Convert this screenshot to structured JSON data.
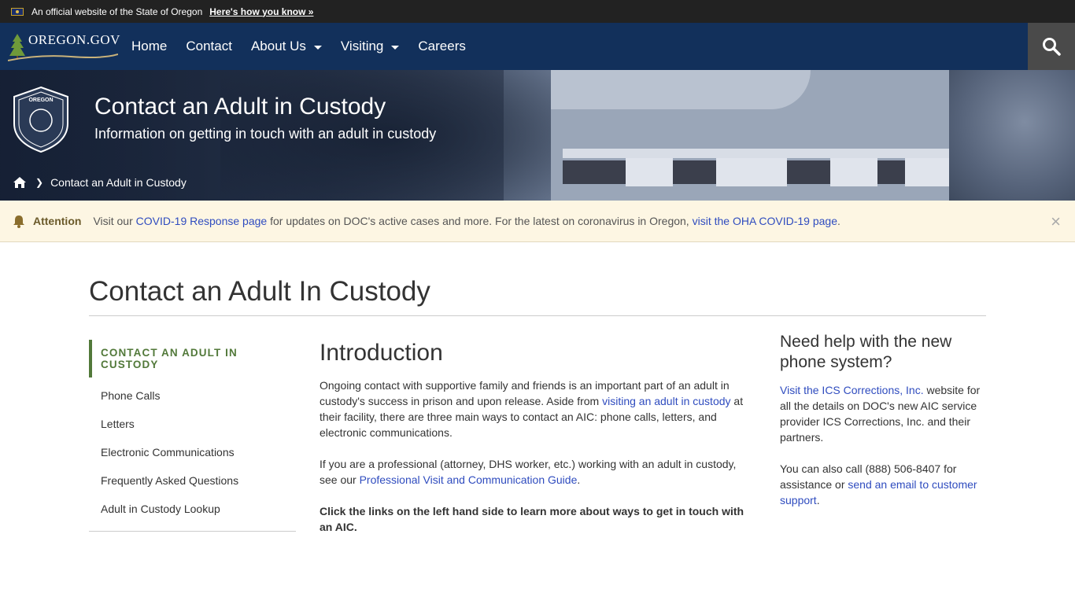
{
  "official_bar": {
    "text": "An official website of the State of Oregon",
    "link": "Here's how you know »"
  },
  "nav": {
    "logo_text": "OREGON.GOV",
    "items": [
      {
        "label": "Home"
      },
      {
        "label": "Contact"
      },
      {
        "label": "About Us"
      },
      {
        "label": "Visiting"
      },
      {
        "label": "Careers"
      }
    ],
    "search_icon": "search-icon"
  },
  "hero": {
    "title": "Contact an Adult in Custody",
    "subtitle": "Information on getting in touch with an adult in custody",
    "seal_text": "OREGON DEPARTMENT OF CORRECTIONS"
  },
  "breadcrumb": {
    "home_icon": "home-icon",
    "current": "Contact an Adult in Custody"
  },
  "alert": {
    "label": "Attention",
    "text1": "Visit our ",
    "link1": "COVID-19 Response page",
    "text2": " for updates on DOC's active cases and more. For the latest on coronavirus in Oregon, ",
    "link2": "visit the OHA COVID-19 page",
    "text3": ".",
    "close": "×"
  },
  "page": {
    "title": "Contact an Adult In Custody"
  },
  "sidebar": {
    "active": "CONTACT AN ADULT IN CUSTODY",
    "items": [
      {
        "label": "Phone Calls"
      },
      {
        "label": "Letters"
      },
      {
        "label": "Electronic Communications"
      },
      {
        "label": "Frequently Asked Questions"
      },
      {
        "label": "Adult in Custody Lookup"
      }
    ]
  },
  "intro": {
    "heading": "Introduction",
    "p1_a": "Ongoing contact with supportive family and friends is an important part of an adult in custody's success in prison and upon release. Aside from ",
    "p1_link": "visiting an adult in custody",
    "p1_b": " at their facility, there are three main ways to contact an AIC: phone calls, letters, and electronic communications.",
    "p2_a": "If you are a professional (attorney, DHS worker, etc.) working with an adult in custody, see our ",
    "p2_link": "Professional Visit and Communication Guide",
    "p2_b": ".",
    "p3": "Click the links on the left hand side to learn more about ways to get in touch with an AIC."
  },
  "help": {
    "heading": "Need help with the new phone system?",
    "p1_link": "Visit the ICS Corrections, Inc.",
    "p1_b": " website for all the details on DOC's new AIC service provider ICS Corrections, Inc. and their partners.",
    "p2_a": "You can also call (888) 506-8407 for assistance or ",
    "p2_link": "send an email to customer support",
    "p2_b": "."
  }
}
